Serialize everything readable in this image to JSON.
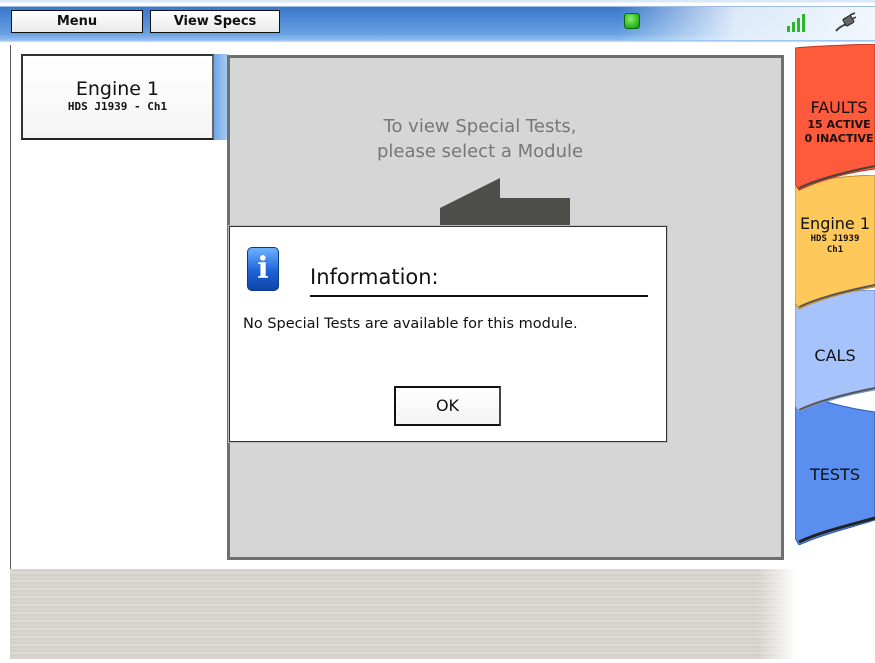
{
  "topbar": {
    "menu_label": "Menu",
    "specs_label": "View Specs",
    "icons": [
      "status-led-icon",
      "signal-strength-icon",
      "cable-connection-icon"
    ],
    "led_color": "#24b41e"
  },
  "module": {
    "title": "Engine 1",
    "subtitle": "HDS J1939 - Ch1"
  },
  "main": {
    "hint_line1": "To view Special Tests,",
    "hint_line2": "please select a Module",
    "arrow_icon": "left-arrow-icon"
  },
  "tabs": [
    {
      "label": "FAULTS",
      "line2": "15 ACTIVE",
      "line3": "0 INACTIVE",
      "color": "#ff5a3c"
    },
    {
      "label": "Engine 1",
      "line2": "HDS J1939",
      "line3": "Ch1",
      "color": "#ffc85a"
    },
    {
      "label": "CALS",
      "color": "#9cbcfb"
    },
    {
      "label": "TESTS",
      "color": "#5a8ff0"
    }
  ],
  "dialog": {
    "title": "Information:",
    "message": "No Special Tests are available for this module.",
    "ok_label": "OK",
    "icon": "info-icon"
  }
}
